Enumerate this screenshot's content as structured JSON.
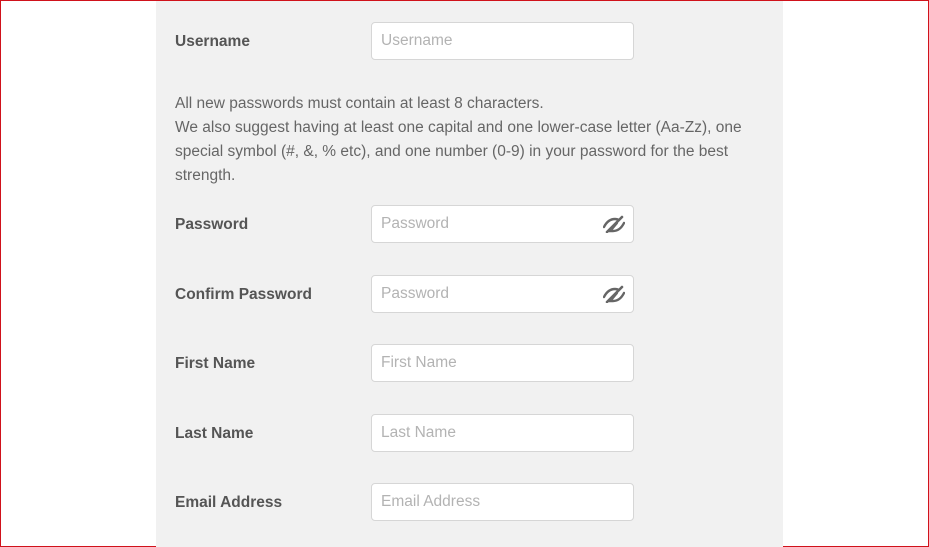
{
  "form": {
    "username": {
      "label": "Username",
      "placeholder": "Username"
    },
    "password_hint": {
      "line1": "All new passwords must contain at least 8 characters.",
      "line2": "We also suggest having at least one capital and one lower-case letter (Aa-Zz), one special symbol (#, &, % etc), and one number (0-9) in your password for the best strength."
    },
    "password": {
      "label": "Password",
      "placeholder": "Password",
      "icon": "eye-slash-icon"
    },
    "confirm_password": {
      "label": "Confirm Password",
      "placeholder": "Password",
      "icon": "eye-slash-icon"
    },
    "first_name": {
      "label": "First Name",
      "placeholder": "First Name"
    },
    "last_name": {
      "label": "Last Name",
      "placeholder": "Last Name"
    },
    "email": {
      "label": "Email Address",
      "placeholder": "Email Address"
    }
  },
  "colors": {
    "panel_background": "#f1f1f1",
    "label_text": "#555555",
    "placeholder_text": "#b3b3b3",
    "frame_border": "#d0121b"
  }
}
